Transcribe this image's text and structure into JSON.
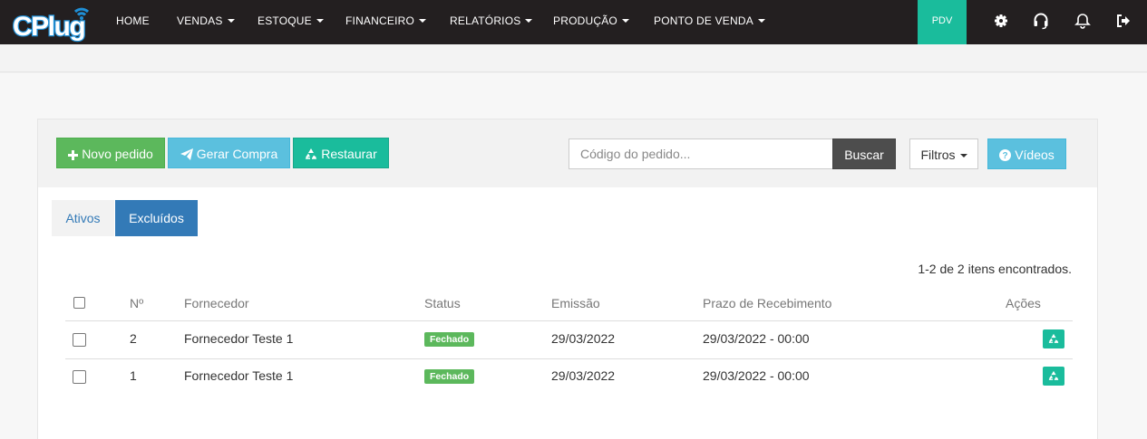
{
  "brand": {
    "logo_text": "CPlug"
  },
  "nav": {
    "items": [
      {
        "label": "HOME",
        "has_caret": false
      },
      {
        "label": "VENDAS",
        "has_caret": true
      },
      {
        "label": "ESTOQUE",
        "has_caret": true
      },
      {
        "label": "FINANCEIRO",
        "has_caret": true
      },
      {
        "label": "RELATÓRIOS",
        "has_caret": true
      },
      {
        "label": "PRODUÇÃO",
        "has_caret": true
      },
      {
        "label": "PONTO DE VENDA",
        "has_caret": true
      }
    ],
    "pdv_label": "PDV",
    "icons": [
      "gear-icon",
      "headset-icon",
      "bell-icon",
      "logout-icon"
    ]
  },
  "toolbar": {
    "new_order_label": "Novo pedido",
    "generate_purchase_label": "Gerar Compra",
    "restore_label": "Restaurar",
    "search_placeholder": "Código do pedido...",
    "search_button_label": "Buscar",
    "filters_label": "Filtros",
    "videos_label": "Vídeos"
  },
  "tabs": [
    {
      "label": "Ativos",
      "active": false
    },
    {
      "label": "Excluídos",
      "active": true
    }
  ],
  "results_summary": "1-2 de 2 itens encontrados.",
  "table": {
    "headers": {
      "number": "Nº",
      "supplier": "Fornecedor",
      "status": "Status",
      "issued": "Emissão",
      "due": "Prazo de Recebimento",
      "actions": "Ações"
    },
    "rows": [
      {
        "number": "2",
        "supplier": "Fornecedor Teste 1",
        "status": "Fechado",
        "issued": "29/03/2022",
        "due": "29/03/2022 - 00:00"
      },
      {
        "number": "1",
        "supplier": "Fornecedor Teste 1",
        "status": "Fechado",
        "issued": "29/03/2022",
        "due": "29/03/2022 - 00:00"
      }
    ]
  },
  "colors": {
    "topbar": "#231f20",
    "accent_teal": "#1abc9c",
    "success_green": "#5cb85c",
    "info_blue": "#5bc0de",
    "primary_blue": "#337ab7",
    "logo_blue": "#1f8fd6"
  }
}
